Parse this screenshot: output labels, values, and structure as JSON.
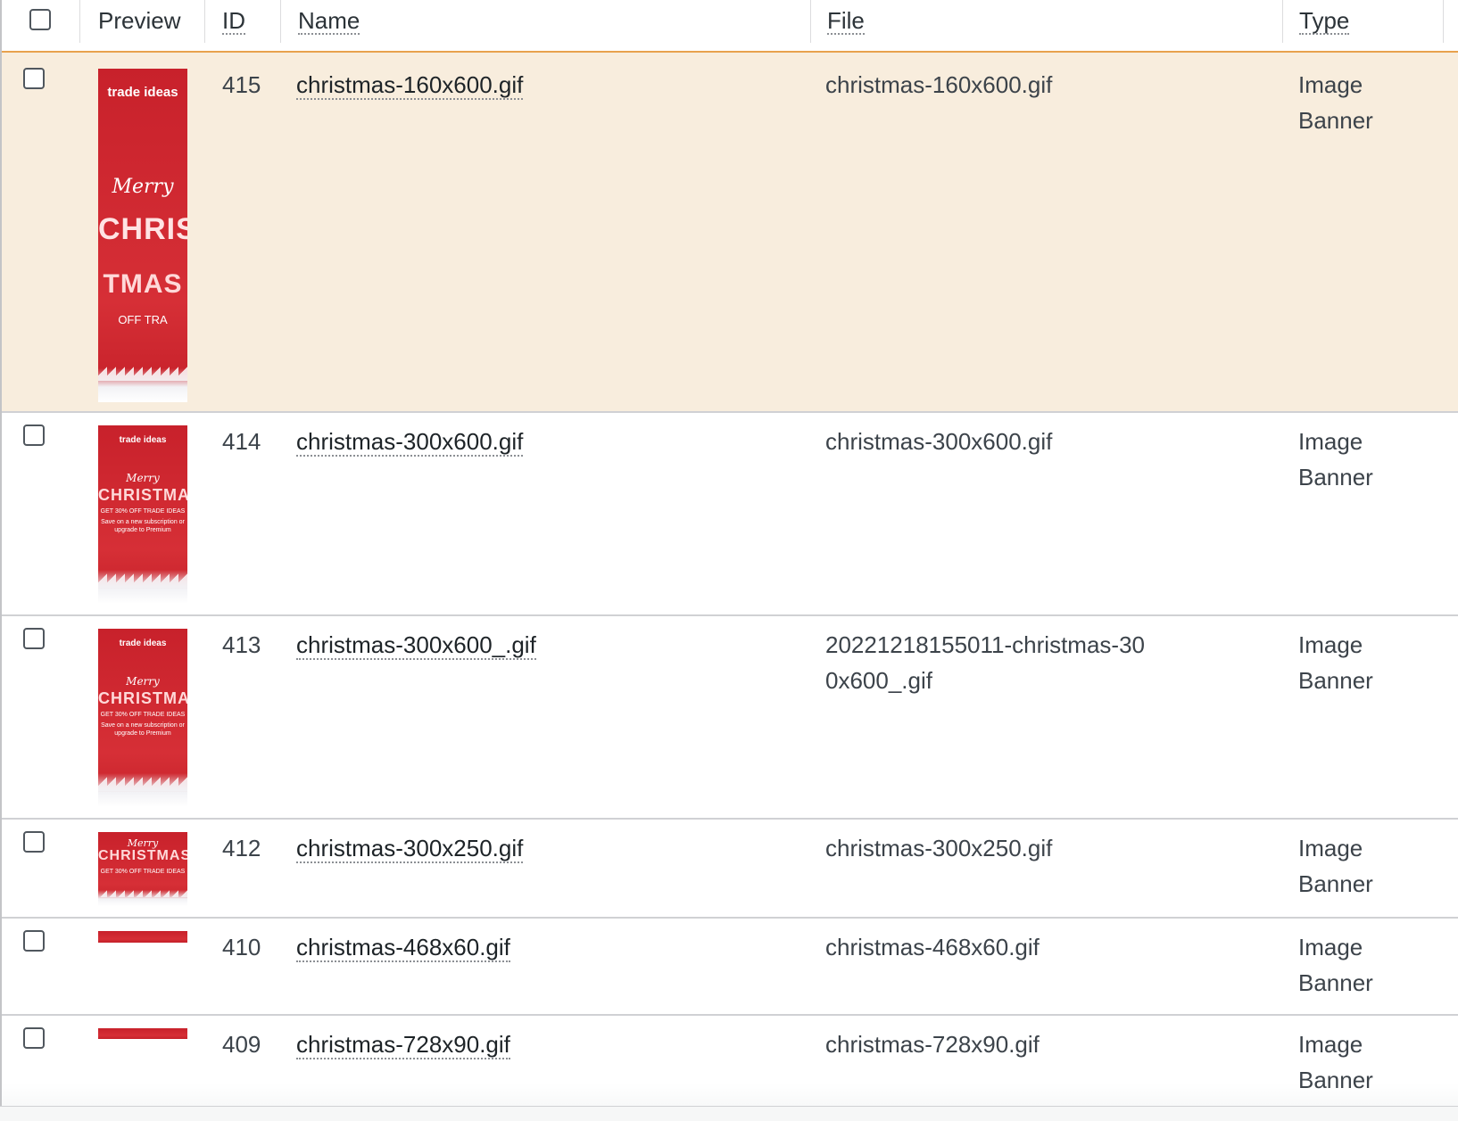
{
  "columns": {
    "preview": "Preview",
    "id": "ID",
    "name": "Name",
    "file": "File",
    "type": "Type"
  },
  "rows": [
    {
      "id": "415",
      "name": "christmas-160x600.gif",
      "file": "christmas-160x600.gif",
      "type": "Image Banner",
      "preview_label": "trade ideas"
    },
    {
      "id": "414",
      "name": "christmas-300x600.gif",
      "file": "christmas-300x600.gif",
      "type": "Image Banner",
      "preview_label": "trade ideas"
    },
    {
      "id": "413",
      "name": "christmas-300x600_.gif",
      "file": "20221218155011-christmas-300x600_.gif",
      "type": "Image Banner",
      "preview_label": "trade ideas"
    },
    {
      "id": "412",
      "name": "christmas-300x250.gif",
      "file": "christmas-300x250.gif",
      "type": "Image Banner",
      "preview_label": ""
    },
    {
      "id": "410",
      "name": "christmas-468x60.gif",
      "file": "christmas-468x60.gif",
      "type": "Image Banner",
      "preview_label": ""
    },
    {
      "id": "409",
      "name": "christmas-728x90.gif",
      "file": "christmas-728x90.gif",
      "type": "Image Banner",
      "preview_label": ""
    }
  ],
  "colors": {
    "highlight_row": "#f8eddd",
    "header_border": "#e8a14d",
    "banner_red": "#c8212b"
  },
  "icons": {
    "row_checkbox": "checkbox-icon",
    "preview": "banner-thumbnail-icon"
  }
}
